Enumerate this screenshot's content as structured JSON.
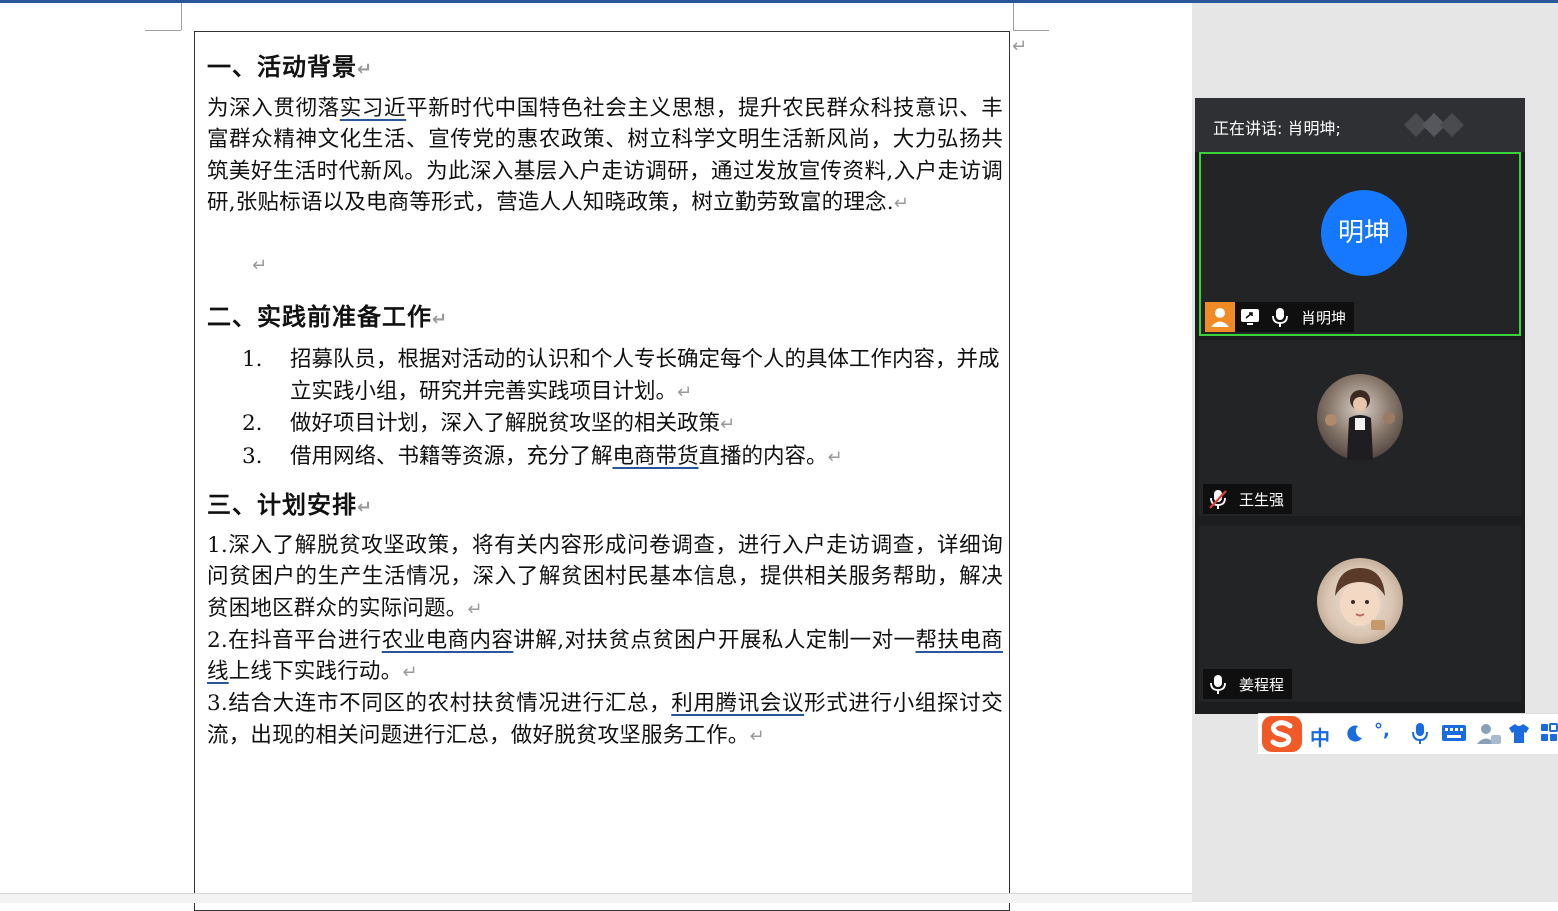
{
  "document": {
    "sections": [
      {
        "heading": "一、活动背景",
        "paragraph": {
          "p1": "为深入贯彻落",
          "p1_link": "实习近",
          "p1_rest": "平新时代中国特色社会主义思想，提升农民群众科技意识、丰富群众精神文化生活、宣传党的惠农政策、树立科学文明生活新风尚，大力弘扬共筑美好生活时代新风。为此深入基层入户走访调研，通过发放宣传资料,入户走访调研,张贴标语以及电商等形式，营造人人知晓政策，树立勤劳致富的理念."
        }
      },
      {
        "heading": "二、实践前准备工作",
        "items": [
          {
            "num": "1.",
            "text": "招募队员，根据对活动的认识和个人专长确定每个人的具体工作内容，并成立实践小组，研究并完善实践项目计划。"
          },
          {
            "num": "2.",
            "text": "做好项目计划，深入了解脱贫攻坚的相关政策"
          },
          {
            "num": "3.",
            "text_a": "借用网络、书籍等资源，充分了解",
            "text_link": "电商带货",
            "text_b": "直播的内容。"
          }
        ]
      },
      {
        "heading": "三、计划安排",
        "p1": "1.深入了解脱贫攻坚政策，将有关内容形成问卷调查，进行入户走访调查，详细询问贫困户的生产生活情况，深入了解贫困村民基本信息，提供相关服务帮助，解决贫困地区群众的实际问题。",
        "p2_a": "2.在抖音平台进行",
        "p2_link1": "农业电商内容",
        "p2_b": "讲解,对扶贫点贫困户开展私人定制一对一",
        "p2_link2": "帮扶电商线",
        "p2_c": "上线下实践行动。",
        "p3_a": "3.结合大连市不同区的农村扶贫情况进行汇总，",
        "p3_link": "利用腾讯会议",
        "p3_b": "形式进行小组探讨交流，出现的相关问题进行汇总，做好脱贫攻坚服务工作。"
      }
    ],
    "para_mark": "↵"
  },
  "meeting": {
    "speaking_label": "正在讲话: 肖明坤;",
    "participants": [
      {
        "avatar_text": "明坤",
        "name": "肖明坤",
        "avatar_color": "#1677ff",
        "muted": false,
        "host": true,
        "sharing": true
      },
      {
        "avatar_text": "",
        "name": "王生强",
        "muted": true
      },
      {
        "avatar_text": "",
        "name": "姜程程",
        "muted": false
      }
    ],
    "accent_color": "#3ad23a"
  },
  "ime_toolbar": {
    "lang_label": "中",
    "punct_label": "°,",
    "icons": [
      "sogou-logo-icon",
      "moon-icon",
      "mic-icon",
      "keyboard-icon",
      "user-icon",
      "shirt-icon",
      "grid-icon"
    ]
  }
}
